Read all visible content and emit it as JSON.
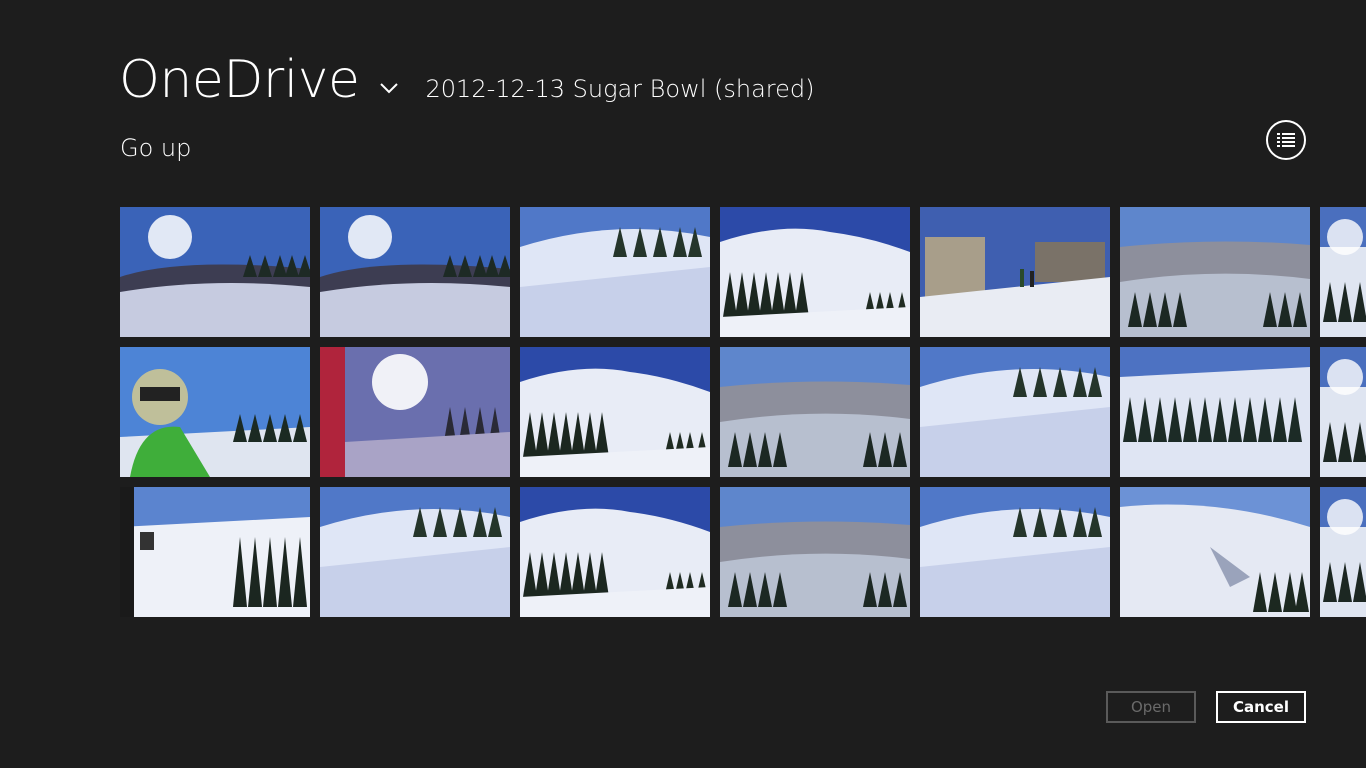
{
  "header": {
    "location": "OneDrive",
    "folder": "2012-12-13 Sugar Bowl (shared)"
  },
  "nav": {
    "go_up": "Go up"
  },
  "view_toggle_icon": "list-view-icon",
  "thumbnails": [
    [
      "sky-snow",
      "sky-snow",
      "slope-trees",
      "ridge-trees",
      "lift-station",
      "valley-vista",
      "partial"
    ],
    [
      "skier-selfie",
      "sun-flare",
      "ridge-trees",
      "valley-vista",
      "slope-trees",
      "forest-snow",
      "partial"
    ],
    [
      "lift-chairs",
      "slope-trees",
      "ridge-trees",
      "valley-vista",
      "slope-trees",
      "snowy-cliff",
      "partial"
    ]
  ],
  "buttons": {
    "open": "Open",
    "cancel": "Cancel"
  },
  "colors": {
    "background": "#1d1d1d",
    "text": "#ffffff",
    "disabled": "#6a6a6a"
  }
}
